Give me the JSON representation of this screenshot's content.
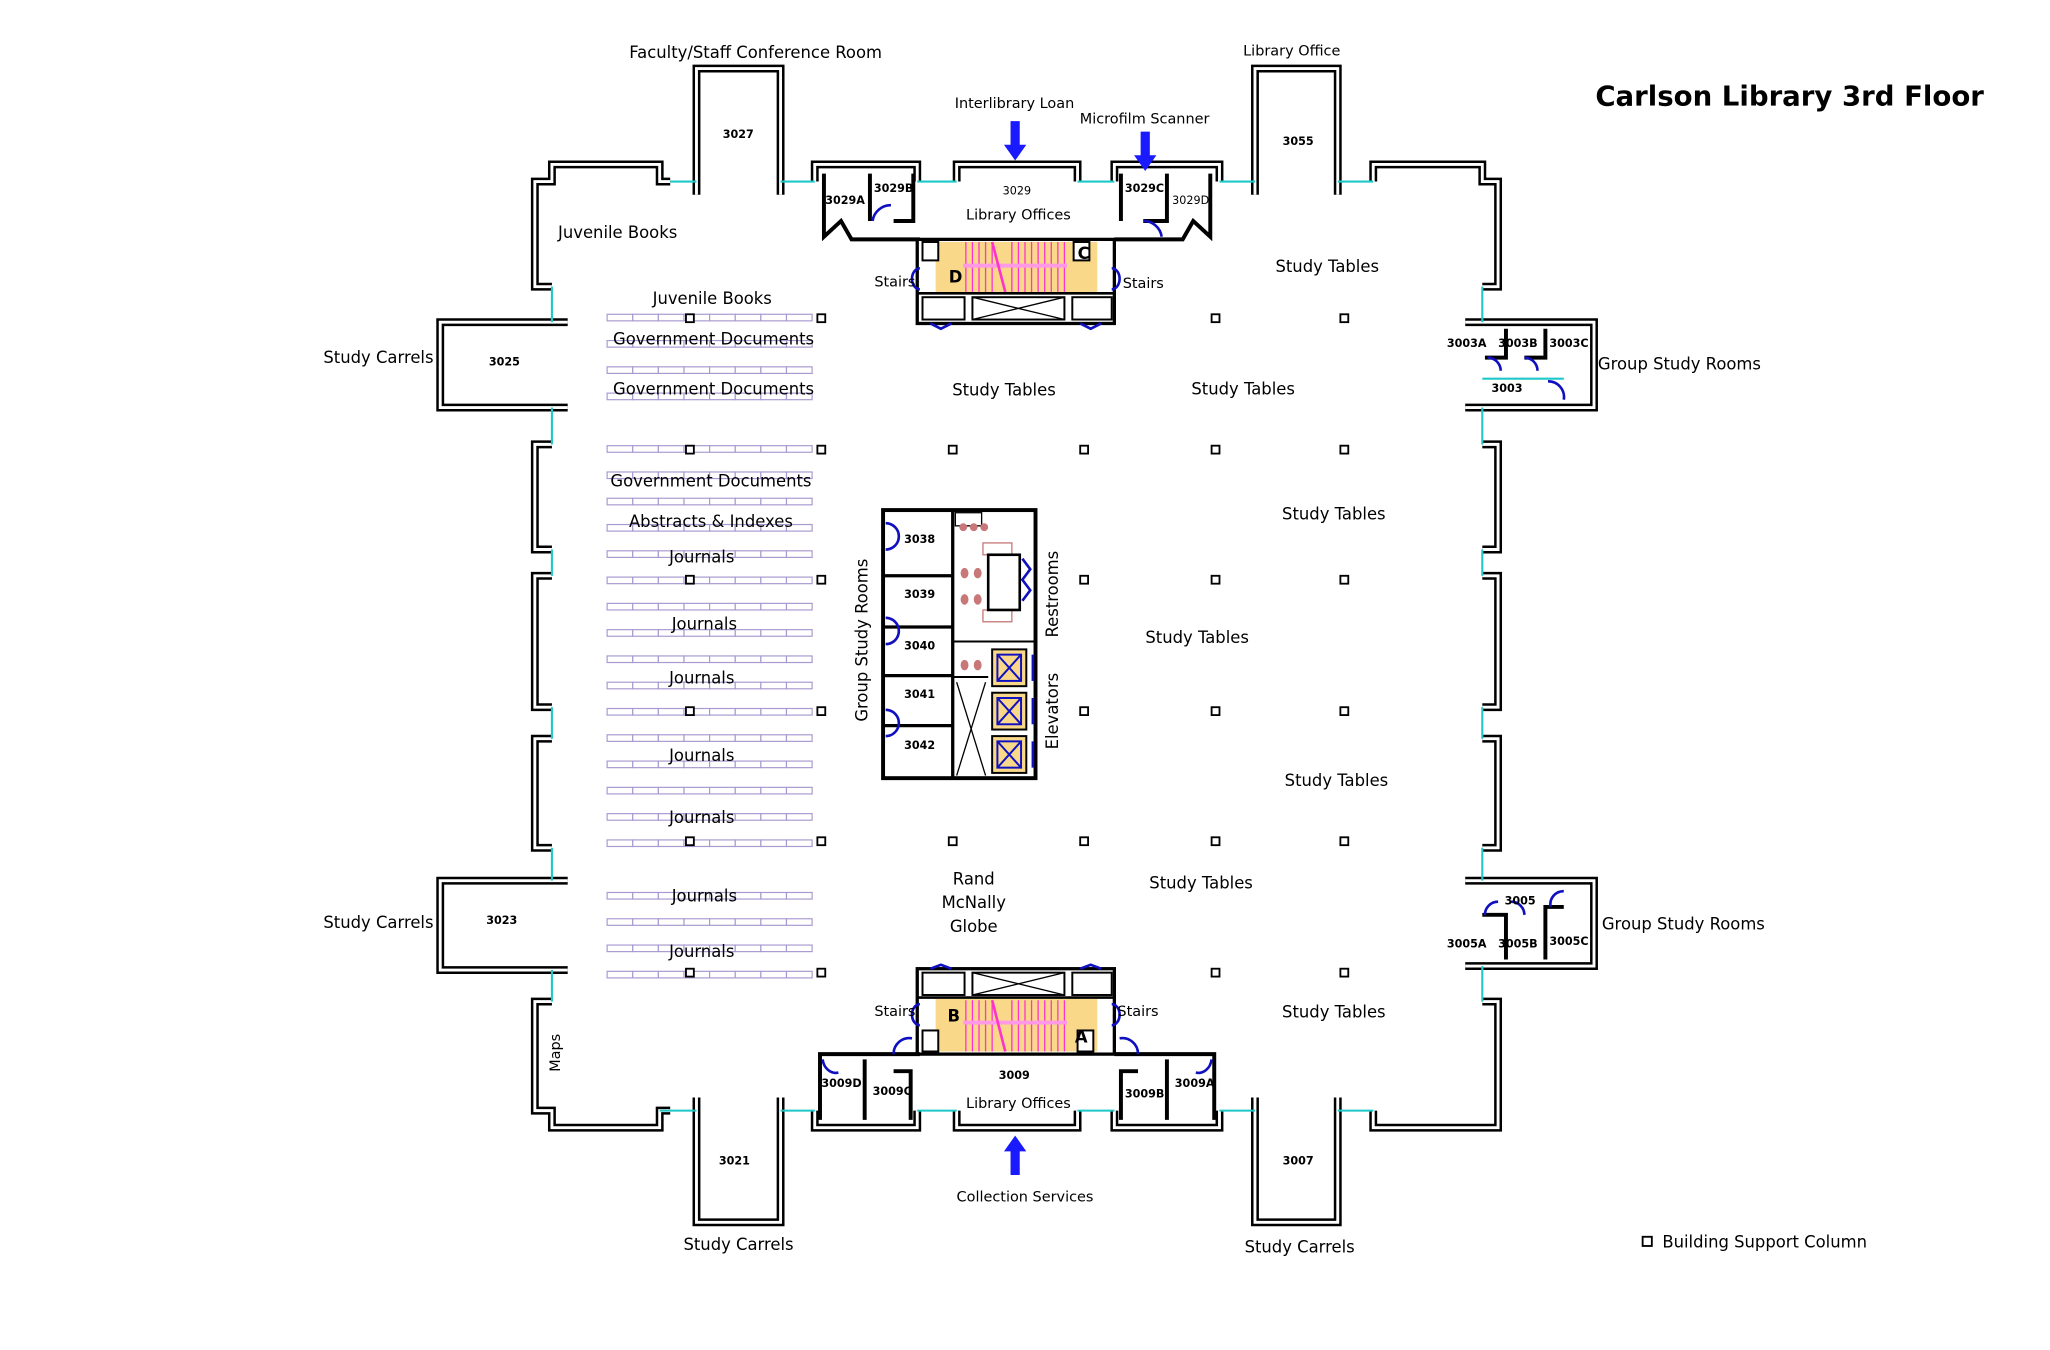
{
  "title": "Carlson Library 3rd Floor",
  "colors": {
    "walls": "#000000",
    "windows": "#1fc8c8",
    "doors": "#1010c0",
    "arrows": "#1a1aff",
    "stair_fill": "#f9d88a",
    "stair_treads": "#ff33cc",
    "shelving": "#a89ad0",
    "restroom_fixtures": "#c87878"
  },
  "rooms": {
    "r3027": "3027",
    "r3029A": "3029A",
    "r3029B": "3029B",
    "r3029": "3029",
    "r3029C": "3029C",
    "r3029D": "3029D",
    "r3055": "3055",
    "r3025": "3025",
    "r3003A": "3003A",
    "r3003B": "3003B",
    "r3003C": "3003C",
    "r3003": "3003",
    "r3038": "3038",
    "r3039": "3039",
    "r3040": "3040",
    "r3041": "3041",
    "r3042": "3042",
    "r3023": "3023",
    "r3005": "3005",
    "r3005A": "3005A",
    "r3005B": "3005B",
    "r3005C": "3005C",
    "r3009D": "3009D",
    "r3009C": "3009C",
    "r3009": "3009",
    "r3009B": "3009B",
    "r3009A": "3009A",
    "r3021": "3021",
    "r3007": "3007"
  },
  "stair_letters": {
    "d": "D",
    "c": "C",
    "b": "B",
    "a": "A"
  },
  "areas": {
    "faculty_conf": "Faculty/Staff Conference Room",
    "library_office": "Library Office",
    "interlibrary_loan": "Interlibrary Loan",
    "microfilm_scanner": "Microfilm Scanner",
    "library_offices_top": "Library Offices",
    "library_offices_bottom": "Library Offices",
    "juvenile_books_1": "Juvenile Books",
    "juvenile_books_2": "Juvenile Books",
    "study_carrels_left_top": "Study Carrels",
    "study_carrels_left_bottom": "Study Carrels",
    "study_carrels_bottom_left": "Study Carrels",
    "study_carrels_bottom_right": "Study Carrels",
    "gov_docs_1": "Government Documents",
    "gov_docs_2": "Government Documents",
    "gov_docs_3": "Government Documents",
    "abstracts": "Abstracts & Indexes",
    "journals": [
      "Journals",
      "Journals",
      "Journals",
      "Journals",
      "Journals",
      "Journals",
      "Journals"
    ],
    "study_tables": [
      "Study Tables",
      "Study Tables",
      "Study Tables",
      "Study Tables",
      "Study Tables",
      "Study Tables",
      "Study Tables",
      "Study Tables"
    ],
    "group_study_right_top": "Group Study Rooms",
    "group_study_right_bottom": "Group Study Rooms",
    "group_study_core": "Group Study Rooms",
    "stairs": [
      "Stairs",
      "Stairs",
      "Stairs",
      "Stairs"
    ],
    "restrooms": "Restrooms",
    "elevators": "Elevators",
    "globe": [
      "Rand",
      "McNally",
      "Globe"
    ],
    "maps": "Maps",
    "collection_services": "Collection Services"
  },
  "legend": {
    "icon": "square-column-icon",
    "label": "Building Support Column"
  }
}
